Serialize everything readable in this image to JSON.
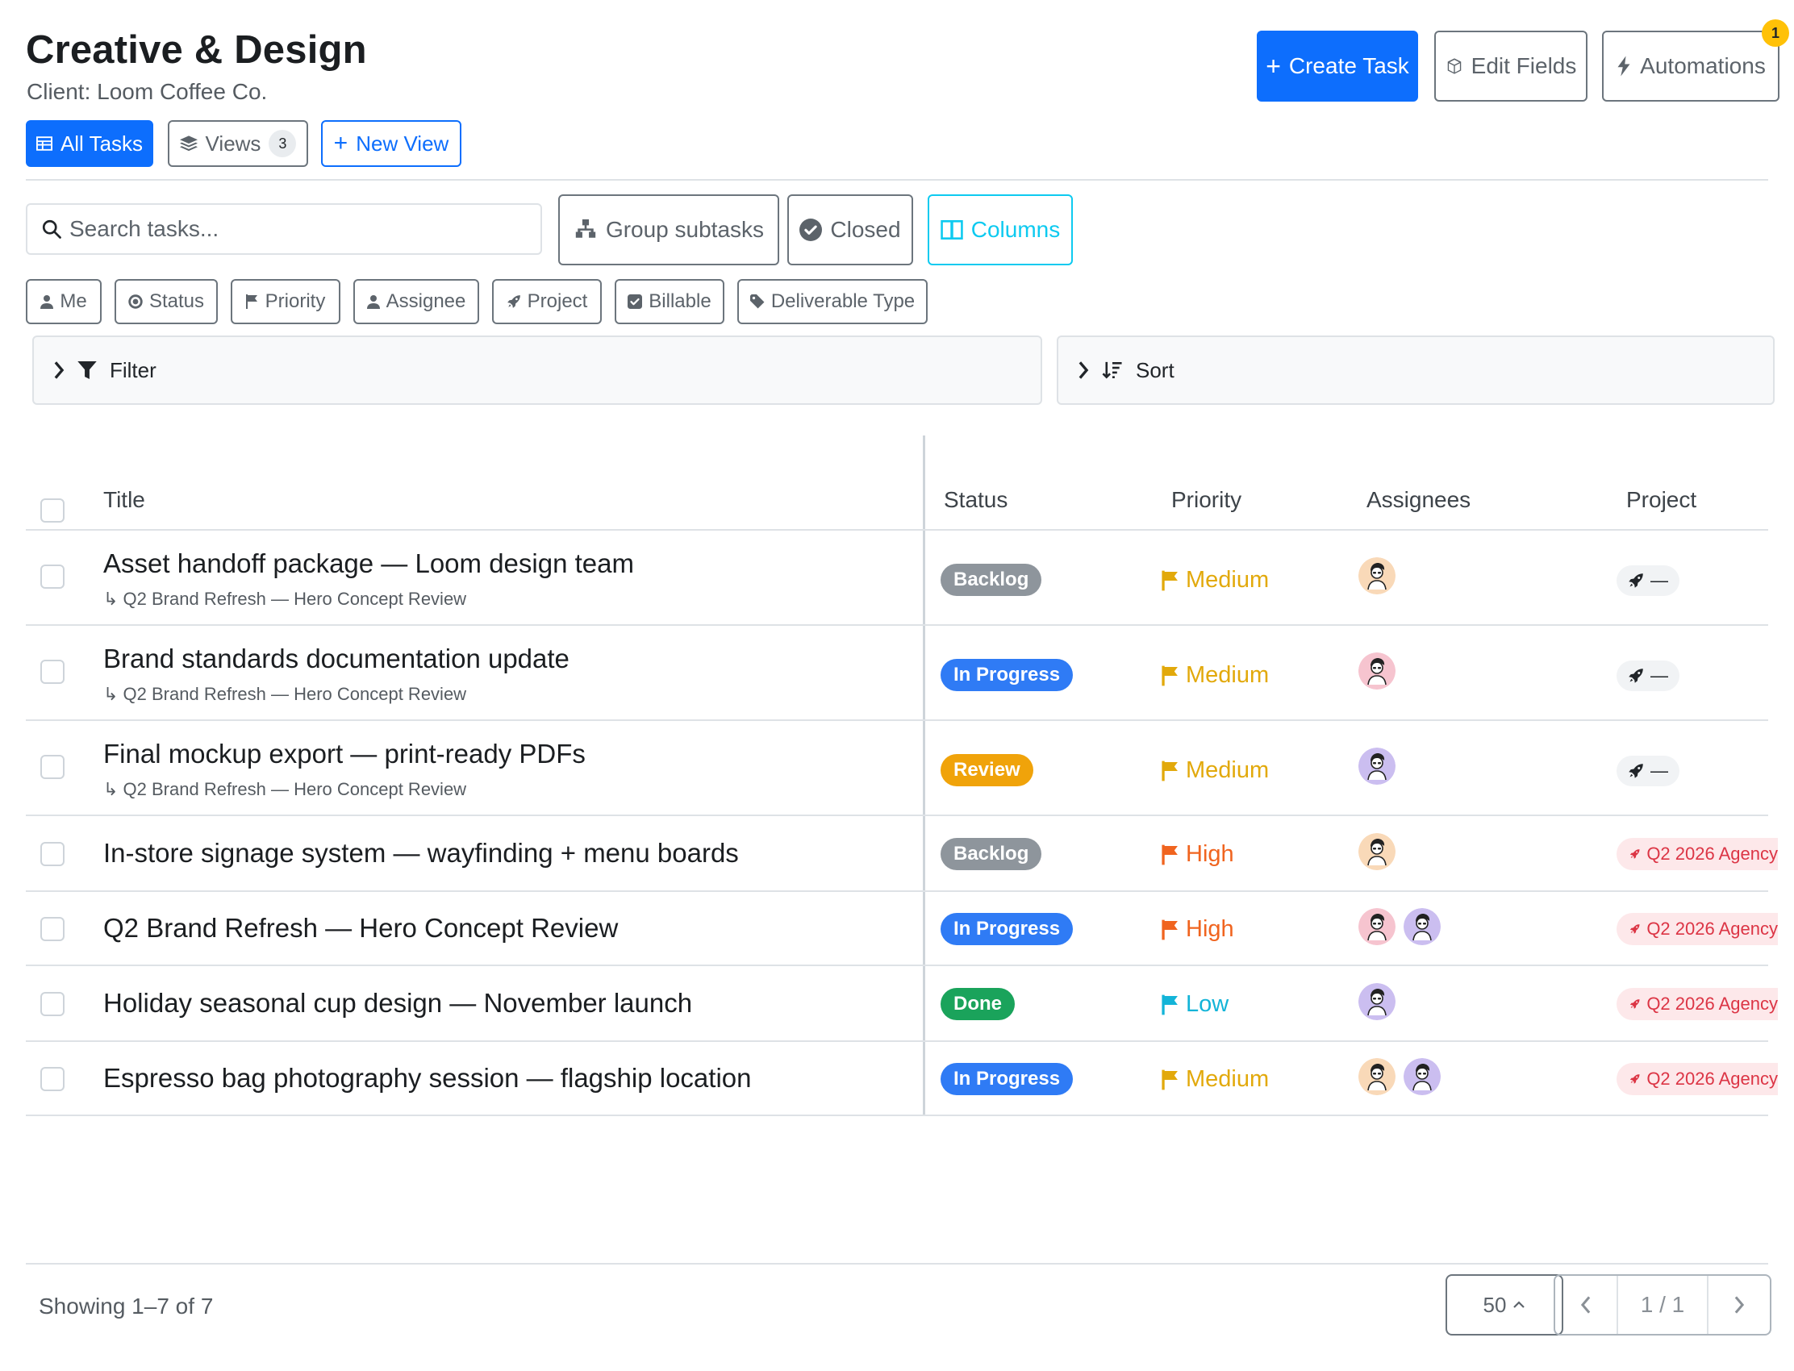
{
  "header": {
    "title": "Creative & Design",
    "subtitle": "Client: Loom Coffee Co.",
    "create_task": "Create Task",
    "edit_fields": "Edit Fields",
    "automations": "Automations",
    "automations_badge": "1"
  },
  "views": {
    "all_tasks": "All Tasks",
    "views": "Views",
    "views_count": "3",
    "new_view": "New View"
  },
  "toolbar": {
    "search_placeholder": "Search tasks...",
    "group_subtasks": "Group subtasks",
    "closed": "Closed",
    "columns": "Columns"
  },
  "chips": [
    "Me",
    "Status",
    "Priority",
    "Assignee",
    "Project",
    "Billable",
    "Deliverable Type"
  ],
  "filter_label": "Filter",
  "sort_label": "Sort",
  "table": {
    "headers": [
      "Title",
      "Status",
      "Priority",
      "Assignees",
      "Project"
    ],
    "rows": [
      {
        "title": "Asset handoff package — Loom design team",
        "parent": "↳ Q2 Brand Refresh — Hero Concept Review",
        "status": "Backlog",
        "priority": "Medium",
        "project": "—"
      },
      {
        "title": "Brand standards documentation update",
        "parent": "↳ Q2 Brand Refresh — Hero Concept Review",
        "status": "In Progress",
        "priority": "Medium",
        "project": "—"
      },
      {
        "title": "Final mockup export — print-ready PDFs",
        "parent": "↳ Q2 Brand Refresh — Hero Concept Review",
        "status": "Review",
        "priority": "Medium",
        "project": "—"
      },
      {
        "title": "In-store signage system — wayfinding + menu boards",
        "parent": "",
        "status": "Backlog",
        "priority": "High",
        "project": "Q2 2026 Agency"
      },
      {
        "title": "Q2 Brand Refresh — Hero Concept Review",
        "parent": "",
        "status": "In Progress",
        "priority": "High",
        "project": "Q2 2026 Agency"
      },
      {
        "title": "Holiday seasonal cup design — November launch",
        "parent": "",
        "status": "Done",
        "priority": "Low",
        "project": "Q2 2026 Agency"
      },
      {
        "title": "Espresso bag photography session — flagship location",
        "parent": "",
        "status": "In Progress",
        "priority": "Medium",
        "project": "Q2 2026 Agency"
      }
    ]
  },
  "colors": {
    "primary": "#0d6efd",
    "backlog": "#8e959c",
    "in_progress": "#2f7bf5",
    "review": "#f0a30a",
    "done": "#1aa35b",
    "medium": "#e2a90b",
    "high": "#f0641f",
    "low": "#13b4d8",
    "project": "#dc3545"
  },
  "footer": {
    "showing": "Showing 1–7 of 7",
    "page_size": "50",
    "page": "1 / 1"
  }
}
